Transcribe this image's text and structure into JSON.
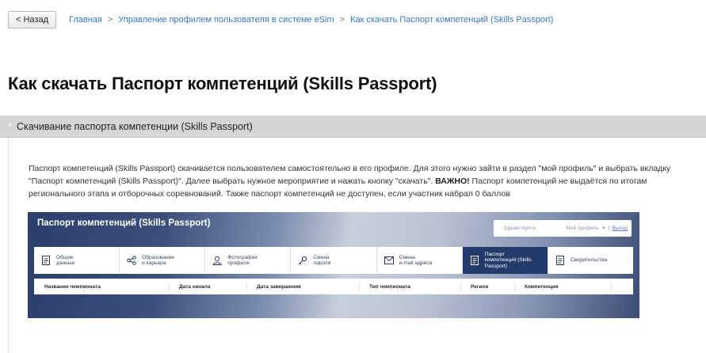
{
  "nav": {
    "back_label": "< Назад",
    "breadcrumbs": [
      "Главная",
      "Управление профилем пользователя в системе eSim",
      "Как скачать Паспорт компетенций (Skills Passport)"
    ],
    "separator": ">"
  },
  "page": {
    "title": "Как скачать Паспорт компетенций (Skills Passport)"
  },
  "accordion": {
    "header": "Скачивание паспорта компетенции (Skills Passport)",
    "paragraph_part1": "Паспорт компетенций (Skills Passport) скачивается пользователем самостоятельно в его профиле. Для этого нужно зайти в раздел \"мой профиль\" и выбрать вкладку \"Паспорт компетенций (Skills Passport)\". Далее выбрать нужное мероприятие и нажать кнопку \"скачать\". ",
    "paragraph_bold": "ВАЖНО!",
    "paragraph_part2": " Паспорт компетенций не выдаётся по итогам регионального этапа и отборочных соревнований. Также паспорт компетенций не доступен, если участник набрал 0 баллов"
  },
  "screenshot": {
    "title": "Паспорт компетенций (Skills Passport)",
    "greeting": "Здравствуйте,",
    "profile_label": "Мой профиль",
    "divider": "|",
    "logout_label": "Выход",
    "tabs": [
      {
        "label": "Общие\nданные",
        "icon": "document-icon",
        "active": false
      },
      {
        "label": "Образование\nи карьера",
        "icon": "share-icon",
        "active": false
      },
      {
        "label": "Фотография\nпрофиля",
        "icon": "camera-icon",
        "active": false
      },
      {
        "label": "Смена\nпароля",
        "icon": "key-icon",
        "active": false
      },
      {
        "label": "Смена\ne-mail адреса",
        "icon": "mail-icon",
        "active": false
      },
      {
        "label": "Паспорт\nкомпетенций (Skills\nPassport)",
        "icon": "document-icon",
        "active": true
      },
      {
        "label": "Свидетельства",
        "icon": "document-icon",
        "active": false
      }
    ],
    "columns": [
      "Название чемпионата",
      "Дата начала",
      "Дата завершения",
      "Тип чемпионата",
      "Регион",
      "Компетенция"
    ],
    "colors": {
      "active_tab": "#233a6b",
      "header_gradient_dark": "#2c3f6c"
    }
  }
}
